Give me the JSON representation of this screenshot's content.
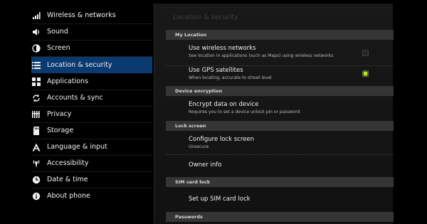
{
  "sidebar": {
    "items": [
      {
        "label": "Wireless & networks",
        "icon": "wireless-icon"
      },
      {
        "label": "Sound",
        "icon": "speaker-icon"
      },
      {
        "label": "Screen",
        "icon": "screen-icon"
      },
      {
        "label": "Location & security",
        "icon": "location-icon",
        "selected": true
      },
      {
        "label": "Applications",
        "icon": "applications-icon"
      },
      {
        "label": "Accounts & sync",
        "icon": "sync-icon"
      },
      {
        "label": "Privacy",
        "icon": "privacy-icon"
      },
      {
        "label": "Storage",
        "icon": "storage-icon"
      },
      {
        "label": "Language & input",
        "icon": "language-icon"
      },
      {
        "label": "Accessibility",
        "icon": "accessibility-icon"
      },
      {
        "label": "Date & time",
        "icon": "clock-icon"
      },
      {
        "label": "About phone",
        "icon": "info-icon"
      }
    ]
  },
  "content": {
    "title": "Location & security",
    "sections": {
      "my_location": "My Location",
      "device_encryption": "Device encryption",
      "lock_screen": "Lock screen",
      "sim_card_lock": "SIM card lock",
      "passwords": "Passwords"
    },
    "rows": {
      "wireless": {
        "title": "Use wireless networks",
        "subtitle": "See location in applications (such as Maps) using wireless networks",
        "checked": false
      },
      "gps": {
        "title": "Use GPS satellites",
        "subtitle": "When locating, accurate to street level",
        "checked": true
      },
      "encrypt": {
        "title": "Encrypt data on device",
        "subtitle": "Requires you to set a device unlock pin or password"
      },
      "configure_lock": {
        "title": "Configure lock screen",
        "subtitle": "Unsecure"
      },
      "owner_info": {
        "title": "Owner info"
      },
      "sim_lock": {
        "title": "Set up SIM card lock"
      }
    }
  },
  "colors": {
    "selected_bg": "#0b3a70",
    "checkbox_on": "#b6e61e",
    "section_bg": "#353535"
  }
}
